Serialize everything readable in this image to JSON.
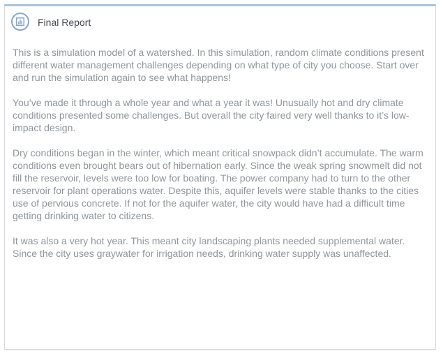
{
  "panel": {
    "title": "Final Report",
    "icon": "bar-chart-icon",
    "paragraphs": [
      "This is a simulation model of a watershed. In this simulation, random climate conditions present different water management challenges depending on what type of city you choose. Start over and run the simulation again to see what happens!",
      "You’ve made it through a whole year and what a year it was! Unusually hot and dry climate conditions presented some challenges. But overall the city faired very well thanks to it’s low-impact design.",
      "Dry conditions began in the winter, which meant critical snowpack didn’t accumulate. The warm conditions even brought bears out of hibernation early. Since the weak spring snowmelt did not fill the reservoir, levels were too low for boating. The power company had to turn to the other reservoir for plant operations water. Despite this, aquifer levels were stable thanks to the cities use of pervious concrete. If not for the aquifer water, the city would have had a difficult time getting drinking water to citizens.",
      "It was also a very hot year. This meant city landscaping plants needed supplemental water. Since the city uses graywater for irrigation needs, drinking water supply was unaffected."
    ]
  },
  "colors": {
    "accent": "#aac4de",
    "icon": "#8aa7c6",
    "title_text": "#444a52",
    "body_text": "#8f959b"
  }
}
